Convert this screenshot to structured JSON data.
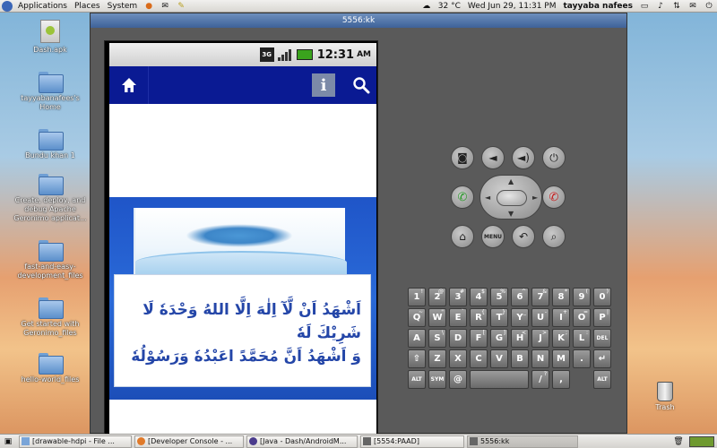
{
  "top_panel": {
    "menu_applications": "Applications",
    "menu_places": "Places",
    "menu_system": "System",
    "temperature": "32 °C",
    "datetime": "Wed Jun 29, 11:31 PM",
    "user": "tayyaba nafees"
  },
  "desktop_icons": [
    {
      "label": "Dash.apk",
      "icon": "apk-file-icon"
    },
    {
      "label": "tayyabanafees's Home",
      "icon": "home-folder-icon"
    },
    {
      "label": "Bundu khan 1",
      "icon": "folder-icon"
    },
    {
      "label": "Create, deploy, and debug Apache Geronimo applicat...",
      "icon": "folder-icon"
    },
    {
      "label": "fast-and-easy-development_files",
      "icon": "folder-icon"
    },
    {
      "label": "Get started with Geronimo_files",
      "icon": "folder-icon"
    },
    {
      "label": "hello-world_files",
      "icon": "folder-icon"
    }
  ],
  "trash": {
    "label": "Trash"
  },
  "emulator": {
    "title": "5556:kk",
    "status": {
      "network": "3G",
      "time": "12:31",
      "ampm": "AM"
    },
    "app": {
      "info_label": "i"
    },
    "shahada_line1": "اَشْهَدُ اَنْ لَّآ اِلٰهَ اِلَّا اللهُ وَحْدَهٗ لَا شَرِيْكَ لَهٗ",
    "shahada_line2": "وَ اَشْهَدُ اَنَّ مُحَمَّدً اعَبْدُهٗ وَرَسُوْلُهٗ",
    "controls": {
      "menu_label": "MENU"
    },
    "keyboard": {
      "row1": [
        {
          "k": "1",
          "s": "!"
        },
        {
          "k": "2",
          "s": "@"
        },
        {
          "k": "3",
          "s": "#"
        },
        {
          "k": "4",
          "s": "$"
        },
        {
          "k": "5",
          "s": "%"
        },
        {
          "k": "6",
          "s": "^"
        },
        {
          "k": "7",
          "s": "&"
        },
        {
          "k": "8",
          "s": "*"
        },
        {
          "k": "9",
          "s": "("
        },
        {
          "k": "0",
          "s": ")"
        }
      ],
      "row2": [
        {
          "k": "Q",
          "s": "~"
        },
        {
          "k": "W",
          "s": "\""
        },
        {
          "k": "E",
          "s": "`"
        },
        {
          "k": "R",
          "s": "{"
        },
        {
          "k": "T",
          "s": "}"
        },
        {
          "k": "Y",
          "s": "_"
        },
        {
          "k": "U",
          "s": "-"
        },
        {
          "k": "I",
          "s": "+"
        },
        {
          "k": "O",
          "s": "="
        },
        {
          "k": "P",
          "s": "|"
        }
      ],
      "row3": [
        {
          "k": "A",
          "s": ""
        },
        {
          "k": "S",
          "s": "\\"
        },
        {
          "k": "D",
          "s": ""
        },
        {
          "k": "F",
          "s": "["
        },
        {
          "k": "G",
          "s": "]"
        },
        {
          "k": "H",
          "s": "<"
        },
        {
          "k": "J",
          "s": ">"
        },
        {
          "k": "K",
          "s": ";"
        },
        {
          "k": "L",
          "s": ":"
        },
        {
          "k": "DEL",
          "s": ""
        }
      ],
      "row4": [
        {
          "k": "⇧",
          "s": ""
        },
        {
          "k": "Z",
          "s": ""
        },
        {
          "k": "X",
          "s": ""
        },
        {
          "k": "C",
          "s": ""
        },
        {
          "k": "V",
          "s": ""
        },
        {
          "k": "B",
          "s": ""
        },
        {
          "k": "N",
          "s": ""
        },
        {
          "k": "M",
          "s": ""
        },
        {
          "k": ".",
          "s": ""
        },
        {
          "k": "↵",
          "s": ""
        }
      ],
      "row5": [
        {
          "k": "ALT",
          "s": ""
        },
        {
          "k": "SYM",
          "s": ""
        },
        {
          "k": "@",
          "s": ""
        },
        {
          "k": "",
          "s": ""
        },
        {
          "k": "/",
          "s": "?"
        },
        {
          "k": ",",
          "s": ""
        },
        {
          "k": "ALT",
          "s": ""
        }
      ]
    }
  },
  "taskbar": [
    {
      "label": "[drawable-hdpi - File ...",
      "icon": "folder-icon",
      "active": false
    },
    {
      "label": "[Developer Console - ...",
      "icon": "firefox-icon",
      "active": false
    },
    {
      "label": "[Java - Dash/AndroidM...",
      "icon": "eclipse-icon",
      "active": false
    },
    {
      "label": "[5554:PAAD]",
      "icon": "window-icon",
      "active": false
    },
    {
      "label": "5556:kk",
      "icon": "window-icon",
      "active": true
    }
  ],
  "colors": {
    "app_bar": "#0a1a93",
    "banner_blue": "#1f55c8",
    "text_blue": "#2446a8",
    "battery_green": "#3aa31d",
    "call_green": "#2a9a2a",
    "end_red": "#c62020"
  }
}
